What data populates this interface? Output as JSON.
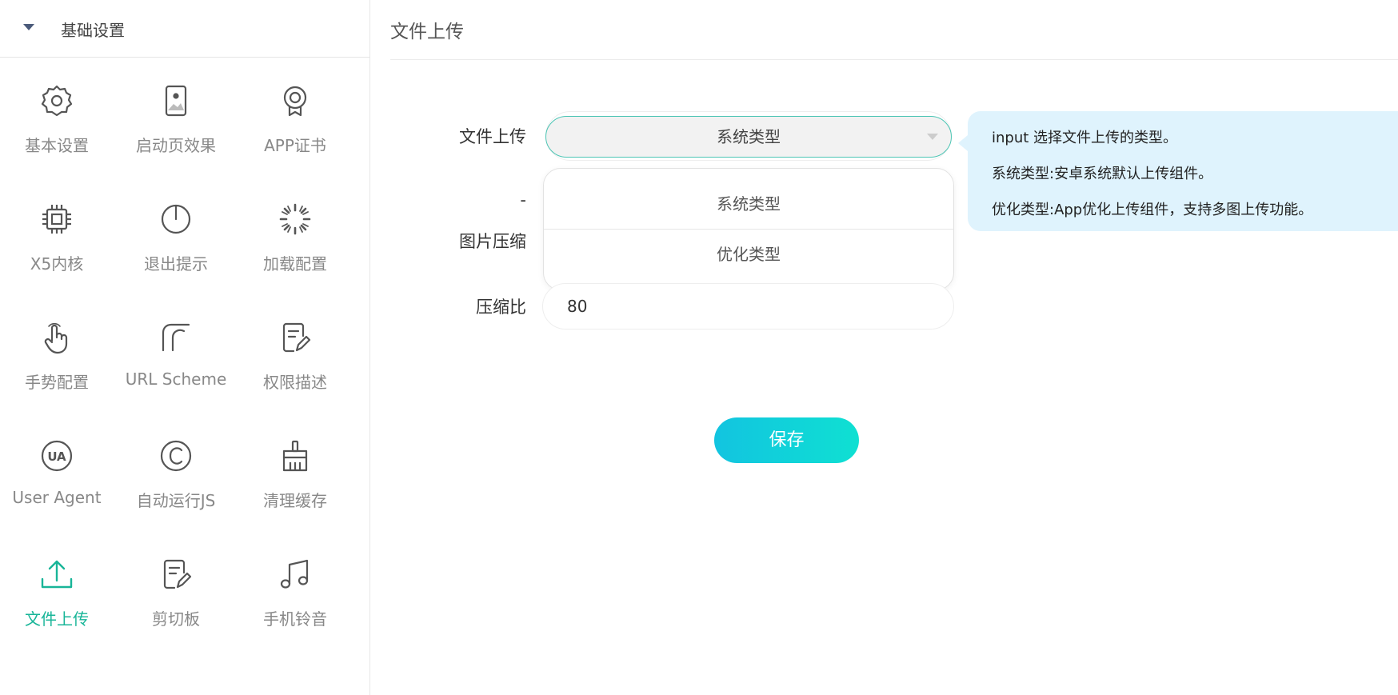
{
  "sidebar": {
    "header": "基础设置",
    "items": [
      {
        "label": "基本设置",
        "icon": "gear-icon"
      },
      {
        "label": "启动页效果",
        "icon": "image-icon"
      },
      {
        "label": "APP证书",
        "icon": "certificate-icon"
      },
      {
        "label": "X5内核",
        "icon": "chip-icon"
      },
      {
        "label": "退出提示",
        "icon": "power-icon"
      },
      {
        "label": "加载配置",
        "icon": "loading-icon"
      },
      {
        "label": "手势配置",
        "icon": "hand-icon"
      },
      {
        "label": "URL Scheme",
        "icon": "url-scheme-icon"
      },
      {
        "label": "权限描述",
        "icon": "document-edit-icon"
      },
      {
        "label": "User Agent",
        "icon": "ua-icon"
      },
      {
        "label": "自动运行JS",
        "icon": "copyright-icon"
      },
      {
        "label": "清理缓存",
        "icon": "broom-icon"
      },
      {
        "label": "文件上传",
        "icon": "upload-icon",
        "active": true
      },
      {
        "label": "剪切板",
        "icon": "clipboard-icon"
      },
      {
        "label": "手机铃音",
        "icon": "music-icon"
      }
    ]
  },
  "main": {
    "title": "文件上传",
    "form": {
      "upload_label": "文件上传",
      "upload_selected": "系统类型",
      "options": [
        "系统类型",
        "优化类型"
      ],
      "hidden_label": "-",
      "compress_label": "图片压缩",
      "ratio_label": "压缩比",
      "ratio_value": "80"
    },
    "save_label": "保存",
    "tooltip": {
      "line1": "input 选择文件上传的类型。",
      "line2": "系统类型:安卓系统默认上传组件。",
      "line3": "优化类型:App优化上传组件，支持多图上传功能。"
    }
  },
  "colors": {
    "accent": "#18b598",
    "select_border": "#4cc5b4",
    "button_start": "#12c4e0",
    "button_end": "#0fe0d2",
    "tooltip_bg": "#dff3fd"
  }
}
